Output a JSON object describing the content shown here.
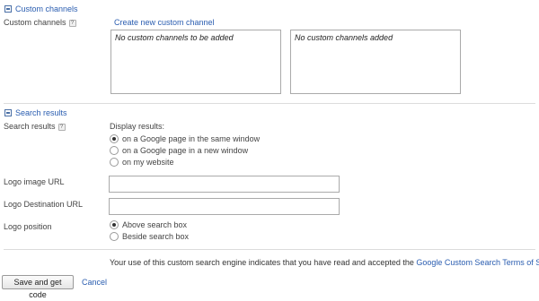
{
  "custom_channels": {
    "section_title": "Custom channels",
    "label": "Custom channels",
    "help": "?",
    "create_link": "Create new custom channel",
    "available_text": "No custom channels to be added",
    "added_text": "No custom channels added"
  },
  "search_results": {
    "section_title": "Search results",
    "label": "Search results",
    "help": "?",
    "display_label": "Display results:",
    "options": [
      {
        "label": "on a Google page in the same window",
        "checked": true
      },
      {
        "label": "on a Google page in a new window",
        "checked": false
      },
      {
        "label": "on my website",
        "checked": false
      }
    ],
    "logo_image_url_label": "Logo image URL",
    "logo_image_url_value": "",
    "logo_destination_url_label": "Logo Destination URL",
    "logo_destination_url_value": "",
    "logo_position_label": "Logo position",
    "logo_position_options": [
      {
        "label": "Above search box",
        "checked": true
      },
      {
        "label": "Beside search box",
        "checked": false
      }
    ]
  },
  "terms": {
    "text": "Your use of this custom search engine indicates that you have read and accepted the",
    "link": "Google Custom Search Terms of Service",
    "end": "."
  },
  "actions": {
    "save_label": "Save and get code",
    "cancel_label": "Cancel"
  }
}
